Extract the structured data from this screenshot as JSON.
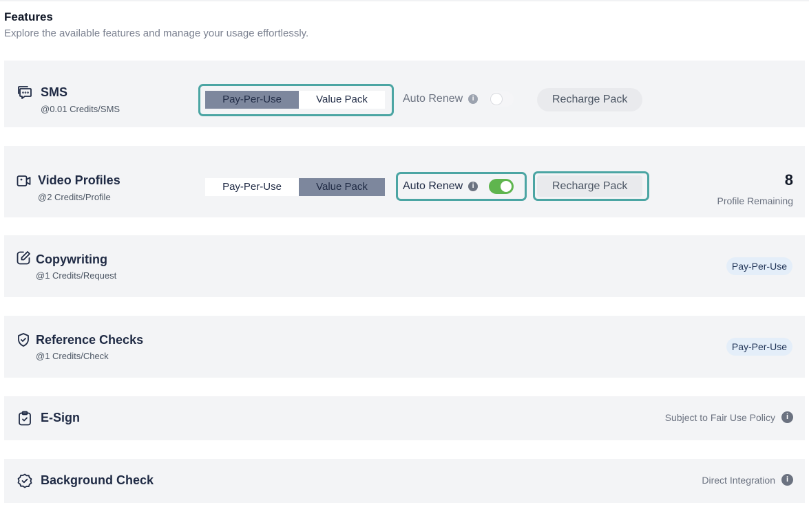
{
  "page": {
    "title": "Features",
    "subtitle": "Explore the available features and manage your usage effortlessly."
  },
  "colors": {
    "highlight": "#4ba5a3",
    "toggle_on": "#5fb54e",
    "active_segment": "#7d879d",
    "row_background": "#f3f4f6"
  },
  "features": {
    "sms": {
      "icon": "chat-bubble-icon",
      "name": "SMS",
      "rate": "@0.01 Credits/SMS",
      "seg_pay": "Pay-Per-Use",
      "seg_value": "Value Pack",
      "selected": "Pay-Per-Use",
      "auto_renew_label": "Auto Renew",
      "auto_renew_on": false,
      "recharge_label": "Recharge Pack"
    },
    "video": {
      "icon": "video-camera-icon",
      "name": "Video Profiles",
      "rate": "@2 Credits/Profile",
      "seg_pay": "Pay-Per-Use",
      "seg_value": "Value Pack",
      "selected": "Value Pack",
      "auto_renew_label": "Auto Renew",
      "auto_renew_on": true,
      "recharge_label": "Recharge Pack",
      "remaining_count": "8",
      "remaining_label": "Profile Remaining"
    },
    "copywriting": {
      "icon": "edit-pen-icon",
      "name": "Copywriting",
      "rate": "@1 Credits/Request",
      "badge": "Pay-Per-Use"
    },
    "reference": {
      "icon": "shield-check-icon",
      "name": "Reference Checks",
      "rate": "@1 Credits/Check",
      "badge": "Pay-Per-Use"
    },
    "esign": {
      "icon": "clipboard-check-icon",
      "name": "E-Sign",
      "note": "Subject to Fair Use Policy"
    },
    "background": {
      "icon": "badge-check-icon",
      "name": "Background Check",
      "note": "Direct Integration"
    }
  }
}
